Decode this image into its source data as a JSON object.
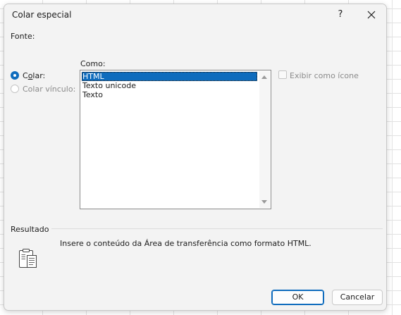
{
  "dialog": {
    "title": "Colar especial",
    "help_glyph": "?",
    "source_label": "Fonte:"
  },
  "paste_options": {
    "paste": {
      "label_pre": "C",
      "label_acc": "o",
      "label_post": "lar:",
      "selected": true
    },
    "paste_link": {
      "label": "Colar vínculo:",
      "selected": false,
      "disabled": true
    }
  },
  "as_list": {
    "label": "Como:",
    "items": [
      "HTML",
      "Texto unicode",
      "Texto"
    ],
    "selected_index": 0
  },
  "display_as_icon": {
    "label": "Exibir como ícone",
    "checked": false,
    "disabled": true
  },
  "result": {
    "label": "Resultado",
    "description": "Insere o conteúdo da Área de transferência como formato HTML.",
    "icon": "clipboard-paste-icon"
  },
  "buttons": {
    "ok": "OK",
    "cancel": "Cancelar"
  },
  "colors": {
    "accent": "#0f6cbd",
    "dialog_bg": "#f3f3f3",
    "disabled_text": "#8a8a8a"
  }
}
